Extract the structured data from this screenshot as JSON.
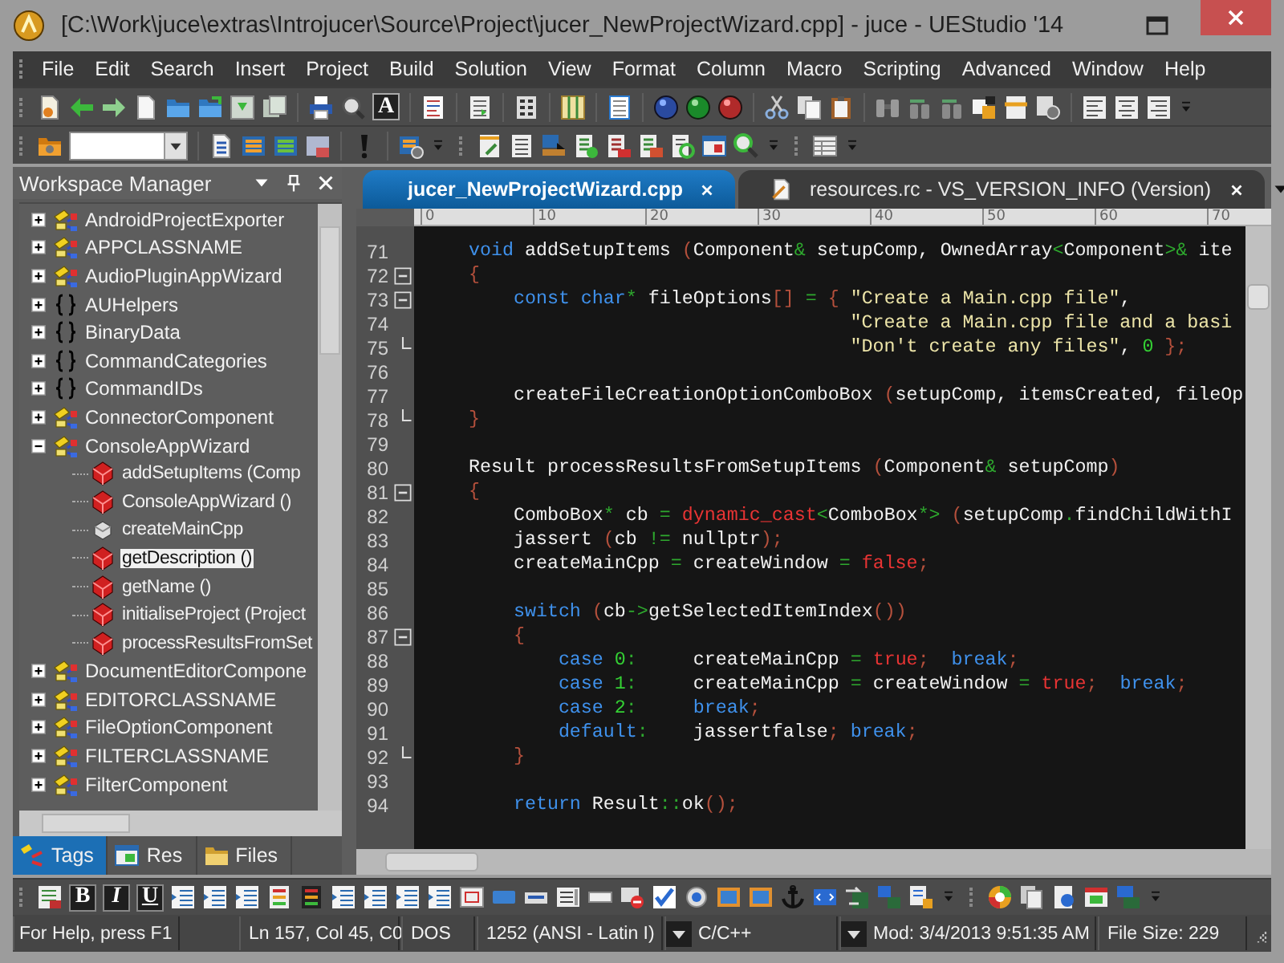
{
  "window": {
    "title": "[C:\\Work\\juce\\extras\\Introjucer\\Source\\Project\\jucer_NewProjectWizard.cpp] - juce - UEStudio '14"
  },
  "menu": [
    "File",
    "Edit",
    "Search",
    "Insert",
    "Project",
    "Build",
    "Solution",
    "View",
    "Format",
    "Column",
    "Macro",
    "Scripting",
    "Advanced",
    "Window",
    "Help"
  ],
  "toolbar_letter_button": "A",
  "format_buttons": [
    "B",
    "I",
    "U"
  ],
  "workspace": {
    "title": "Workspace Manager",
    "tree": [
      {
        "label": "AndroidProjectExporter",
        "kind": "class",
        "expanded": false,
        "selected": false
      },
      {
        "label": "APPCLASSNAME",
        "kind": "class",
        "expanded": false,
        "selected": false
      },
      {
        "label": "AudioPluginAppWizard",
        "kind": "class",
        "expanded": false,
        "selected": false
      },
      {
        "label": "AUHelpers",
        "kind": "namespace",
        "expanded": false,
        "selected": false
      },
      {
        "label": "BinaryData",
        "kind": "namespace",
        "expanded": false,
        "selected": false
      },
      {
        "label": "CommandCategories",
        "kind": "namespace",
        "expanded": false,
        "selected": false
      },
      {
        "label": "CommandIDs",
        "kind": "namespace",
        "expanded": false,
        "selected": false
      },
      {
        "label": "ConnectorComponent",
        "kind": "class",
        "expanded": false,
        "selected": false
      },
      {
        "label": "ConsoleAppWizard",
        "kind": "class",
        "expanded": true,
        "selected": false,
        "children": [
          {
            "label": "addSetupItems (Comp",
            "kind": "method",
            "selected": false
          },
          {
            "label": "ConsoleAppWizard ()",
            "kind": "method",
            "selected": false
          },
          {
            "label": "createMainCpp",
            "kind": "member",
            "selected": false
          },
          {
            "label": "getDescription ()",
            "kind": "method",
            "selected": true
          },
          {
            "label": "getName ()",
            "kind": "method",
            "selected": false
          },
          {
            "label": "initialiseProject (Project",
            "kind": "method",
            "selected": false
          },
          {
            "label": "processResultsFromSet",
            "kind": "method",
            "selected": false
          }
        ]
      },
      {
        "label": "DocumentEditorCompone",
        "kind": "class",
        "expanded": false,
        "selected": false
      },
      {
        "label": "EDITORCLASSNAME",
        "kind": "class",
        "expanded": false,
        "selected": false
      },
      {
        "label": "FileOptionComponent",
        "kind": "class",
        "expanded": false,
        "selected": false
      },
      {
        "label": "FILTERCLASSNAME",
        "kind": "class",
        "expanded": false,
        "selected": false
      },
      {
        "label": "FilterComponent",
        "kind": "class",
        "expanded": false,
        "selected": false
      }
    ],
    "tabs": [
      {
        "label": "Tags",
        "kind": "tags",
        "selected": true
      },
      {
        "label": "Res",
        "kind": "res",
        "selected": false
      },
      {
        "label": "Files",
        "kind": "files",
        "selected": false
      }
    ]
  },
  "editor": {
    "tabs": [
      {
        "label": "jucer_NewProjectWizard.cpp",
        "selected": true
      },
      {
        "label": "resources.rc - VS_VERSION_INFO (Version)",
        "selected": false
      }
    ],
    "ruler": [
      "0",
      "10",
      "20",
      "30",
      "40",
      "50",
      "60",
      "70"
    ],
    "lines": [
      {
        "number": "71",
        "collapsible": false,
        "block_end": false,
        "tokens": [
          {
            "kind": "kw",
            "text": "    void"
          },
          {
            "kind": "plain",
            "text": " addSetupItems "
          },
          {
            "kind": "punct",
            "text": "("
          },
          {
            "kind": "plain",
            "text": "Component"
          },
          {
            "kind": "op",
            "text": "&"
          },
          {
            "kind": "plain",
            "text": " setupComp, OwnedArray"
          },
          {
            "kind": "op",
            "text": "<"
          },
          {
            "kind": "plain",
            "text": "Component"
          },
          {
            "kind": "op",
            "text": ">&"
          },
          {
            "kind": "plain",
            "text": " ite"
          }
        ]
      },
      {
        "number": "72",
        "collapsible": true,
        "block_end": false,
        "tokens": [
          {
            "kind": "punct",
            "text": "    {"
          }
        ]
      },
      {
        "number": "73",
        "collapsible": true,
        "block_end": false,
        "tokens": [
          {
            "kind": "kw",
            "text": "        const char"
          },
          {
            "kind": "op",
            "text": "*"
          },
          {
            "kind": "plain",
            "text": " fileOptions"
          },
          {
            "kind": "punct",
            "text": "[]"
          },
          {
            "kind": "op",
            "text": " ="
          },
          {
            "kind": "punct",
            "text": " {"
          },
          {
            "kind": "str",
            "text": " \"Create a Main.cpp file\""
          },
          {
            "kind": "plain",
            "text": ","
          }
        ]
      },
      {
        "number": "74",
        "collapsible": false,
        "block_end": false,
        "tokens": [
          {
            "kind": "str",
            "text": "                                      \"Create a Main.cpp file and a basi"
          }
        ]
      },
      {
        "number": "75",
        "collapsible": false,
        "block_end": true,
        "tokens": [
          {
            "kind": "str",
            "text": "                                      \"Don't create any files\""
          },
          {
            "kind": "plain",
            "text": ", "
          },
          {
            "kind": "num",
            "text": "0"
          },
          {
            "kind": "punct",
            "text": " };"
          }
        ]
      },
      {
        "number": "76",
        "collapsible": false,
        "block_end": false
      },
      {
        "number": "77",
        "collapsible": false,
        "block_end": false,
        "tokens": [
          {
            "kind": "plain",
            "text": "        createFileCreationOptionComboBox "
          },
          {
            "kind": "punct",
            "text": "("
          },
          {
            "kind": "plain",
            "text": "setupComp, itemsCreated, fileOp"
          }
        ]
      },
      {
        "number": "78",
        "collapsible": false,
        "block_end": true,
        "tokens": [
          {
            "kind": "punct",
            "text": "    }"
          }
        ]
      },
      {
        "number": "79",
        "collapsible": false,
        "block_end": false
      },
      {
        "number": "80",
        "collapsible": false,
        "block_end": false,
        "tokens": [
          {
            "kind": "plain",
            "text": "    Result processResultsFromSetupItems "
          },
          {
            "kind": "punct",
            "text": "("
          },
          {
            "kind": "plain",
            "text": "Component"
          },
          {
            "kind": "op",
            "text": "&"
          },
          {
            "kind": "plain",
            "text": " setupComp"
          },
          {
            "kind": "punct",
            "text": ")"
          }
        ]
      },
      {
        "number": "81",
        "collapsible": true,
        "block_end": false,
        "tokens": [
          {
            "kind": "punct",
            "text": "    {"
          }
        ]
      },
      {
        "number": "82",
        "collapsible": false,
        "block_end": false,
        "tokens": [
          {
            "kind": "plain",
            "text": "        ComboBox"
          },
          {
            "kind": "op",
            "text": "*"
          },
          {
            "kind": "plain",
            "text": " cb "
          },
          {
            "kind": "op",
            "text": "="
          },
          {
            "kind": "lit",
            "text": " dynamic_cast"
          },
          {
            "kind": "op",
            "text": "<"
          },
          {
            "kind": "plain",
            "text": "ComboBox"
          },
          {
            "kind": "op",
            "text": "*>"
          },
          {
            "kind": "punct",
            "text": " ("
          },
          {
            "kind": "plain",
            "text": "setupComp"
          },
          {
            "kind": "op",
            "text": "."
          },
          {
            "kind": "plain",
            "text": "findChildWithI"
          }
        ]
      },
      {
        "number": "83",
        "collapsible": false,
        "block_end": false,
        "tokens": [
          {
            "kind": "plain",
            "text": "        jassert "
          },
          {
            "kind": "punct",
            "text": "("
          },
          {
            "kind": "plain",
            "text": "cb "
          },
          {
            "kind": "op",
            "text": "!="
          },
          {
            "kind": "plain",
            "text": " nullptr"
          },
          {
            "kind": "punct",
            "text": ");"
          }
        ]
      },
      {
        "number": "84",
        "collapsible": false,
        "block_end": false,
        "tokens": [
          {
            "kind": "plain",
            "text": "        createMainCpp "
          },
          {
            "kind": "op",
            "text": "="
          },
          {
            "kind": "plain",
            "text": " createWindow "
          },
          {
            "kind": "op",
            "text": "="
          },
          {
            "kind": "lit",
            "text": " false"
          },
          {
            "kind": "punct",
            "text": ";"
          }
        ]
      },
      {
        "number": "85",
        "collapsible": false,
        "block_end": false
      },
      {
        "number": "86",
        "collapsible": false,
        "block_end": false,
        "tokens": [
          {
            "kind": "kw",
            "text": "        switch"
          },
          {
            "kind": "punct",
            "text": " ("
          },
          {
            "kind": "plain",
            "text": "cb"
          },
          {
            "kind": "op",
            "text": "->"
          },
          {
            "kind": "plain",
            "text": "getSelectedItemIndex"
          },
          {
            "kind": "punct",
            "text": "())"
          }
        ]
      },
      {
        "number": "87",
        "collapsible": true,
        "block_end": false,
        "tokens": [
          {
            "kind": "punct",
            "text": "        {"
          }
        ]
      },
      {
        "number": "88",
        "collapsible": false,
        "block_end": false,
        "tokens": [
          {
            "kind": "kw",
            "text": "            case"
          },
          {
            "kind": "num",
            "text": " 0"
          },
          {
            "kind": "op",
            "text": ":"
          },
          {
            "kind": "plain",
            "text": "     createMainCpp "
          },
          {
            "kind": "op",
            "text": "="
          },
          {
            "kind": "lit",
            "text": " true"
          },
          {
            "kind": "punct",
            "text": ";"
          },
          {
            "kind": "kw",
            "text": "  break"
          },
          {
            "kind": "punct",
            "text": ";"
          }
        ]
      },
      {
        "number": "89",
        "collapsible": false,
        "block_end": false,
        "tokens": [
          {
            "kind": "kw",
            "text": "            case"
          },
          {
            "kind": "num",
            "text": " 1"
          },
          {
            "kind": "op",
            "text": ":"
          },
          {
            "kind": "plain",
            "text": "     createMainCpp "
          },
          {
            "kind": "op",
            "text": "="
          },
          {
            "kind": "plain",
            "text": " createWindow "
          },
          {
            "kind": "op",
            "text": "="
          },
          {
            "kind": "lit",
            "text": " true"
          },
          {
            "kind": "punct",
            "text": ";"
          },
          {
            "kind": "kw",
            "text": "  break"
          },
          {
            "kind": "punct",
            "text": ";"
          }
        ]
      },
      {
        "number": "90",
        "collapsible": false,
        "block_end": false,
        "tokens": [
          {
            "kind": "kw",
            "text": "            case"
          },
          {
            "kind": "num",
            "text": " 2"
          },
          {
            "kind": "op",
            "text": ":"
          },
          {
            "kind": "kw",
            "text": "     break"
          },
          {
            "kind": "punct",
            "text": ";"
          }
        ]
      },
      {
        "number": "91",
        "collapsible": false,
        "block_end": false,
        "tokens": [
          {
            "kind": "kw",
            "text": "            default"
          },
          {
            "kind": "op",
            "text": ":"
          },
          {
            "kind": "plain",
            "text": "    jassertfalse"
          },
          {
            "kind": "punct",
            "text": ";"
          },
          {
            "kind": "kw",
            "text": " break"
          },
          {
            "kind": "punct",
            "text": ";"
          }
        ]
      },
      {
        "number": "92",
        "collapsible": false,
        "block_end": true,
        "tokens": [
          {
            "kind": "punct",
            "text": "        }"
          }
        ]
      },
      {
        "number": "93",
        "collapsible": false,
        "block_end": false
      },
      {
        "number": "94",
        "collapsible": false,
        "block_end": false,
        "tokens": [
          {
            "kind": "kw",
            "text": "        return"
          },
          {
            "kind": "plain",
            "text": " Result"
          },
          {
            "kind": "op",
            "text": "::"
          },
          {
            "kind": "plain",
            "text": "ok"
          },
          {
            "kind": "punct",
            "text": "();"
          }
        ]
      }
    ]
  },
  "status_bar": [
    {
      "text": "For Help, press F1",
      "kind": "text"
    },
    {
      "text": "Ln 157, Col 45, C0",
      "kind": "text"
    },
    {
      "text": "DOS",
      "kind": "text"
    },
    {
      "text": "1252  (ANSI - Latin I)",
      "kind": "text"
    },
    {
      "text": "C/C++",
      "kind": "dropdown"
    },
    {
      "text": "Mod: 3/4/2013 9:51:35 AM",
      "kind": "dropdown"
    },
    {
      "text": "File Size: 229",
      "kind": "text"
    }
  ]
}
